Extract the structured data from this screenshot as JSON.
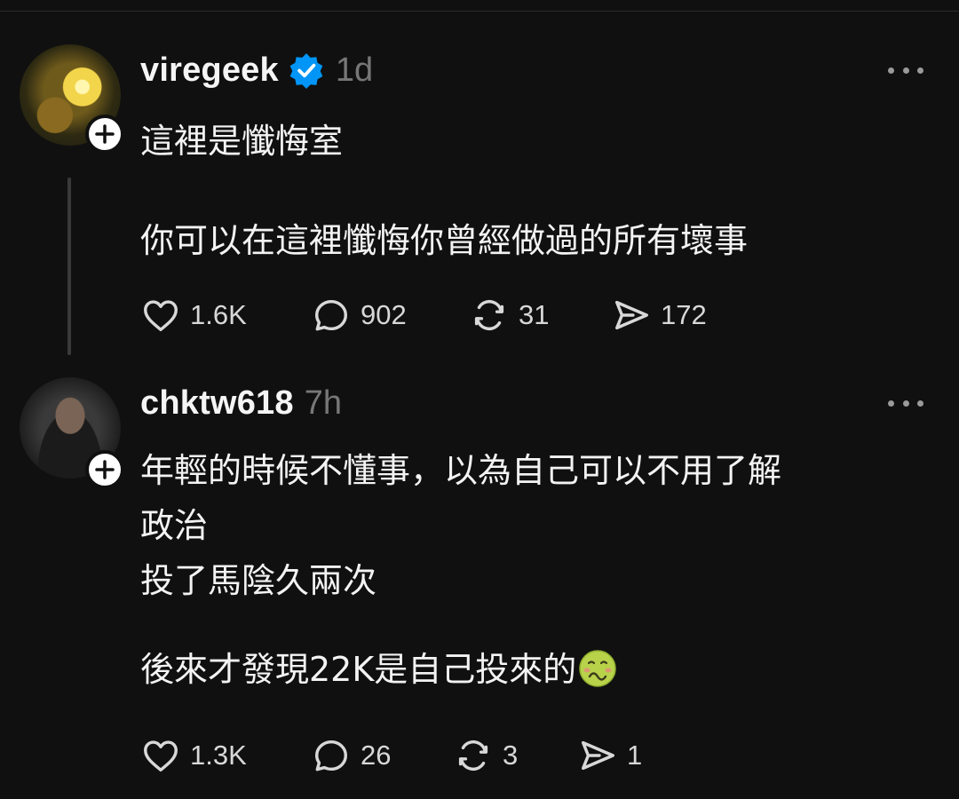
{
  "posts": [
    {
      "username": "viregeek",
      "verified": true,
      "time": "1d",
      "paragraphs": [
        "這裡是懺悔室",
        "你可以在這裡懺悔你曾經做過的所有壞事"
      ],
      "stats": {
        "likes": "1.6K",
        "comments": "902",
        "reposts": "31",
        "shares": "172"
      }
    },
    {
      "username": "chktw618",
      "verified": false,
      "time": "7h",
      "paragraphs": [
        "年輕的時候不懂事，以為自己可以不用了解\n政治\n投了馬陰久兩次",
        "後來才發現22K是自己投來的"
      ],
      "emoji": "nauseated-face-icon",
      "stats": {
        "likes": "1.3K",
        "comments": "26",
        "reposts": "3",
        "shares": "1"
      }
    }
  ],
  "colors": {
    "background": "#101010",
    "verified": "#0095f6",
    "muted": "#777777"
  }
}
